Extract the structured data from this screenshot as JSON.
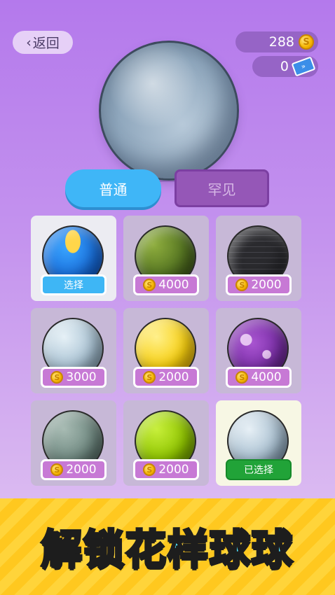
{
  "header": {
    "back_label": "返回",
    "coins": "288",
    "tickets": "0"
  },
  "tabs": [
    {
      "label": "普通",
      "active": true
    },
    {
      "label": "罕见",
      "active": false
    }
  ],
  "balls": [
    {
      "skin": "blue-flame",
      "action": "选择",
      "state": "owned"
    },
    {
      "skin": "green-camo",
      "price": "4000",
      "state": "locked"
    },
    {
      "skin": "dark-brick",
      "price": "2000",
      "state": "locked"
    },
    {
      "skin": "icy-blue",
      "price": "3000",
      "state": "locked"
    },
    {
      "skin": "yellow",
      "price": "2000",
      "state": "locked"
    },
    {
      "skin": "purple-marble",
      "price": "4000",
      "state": "locked"
    },
    {
      "skin": "gray-green-stone",
      "price": "2000",
      "state": "locked"
    },
    {
      "skin": "lime-green",
      "price": "2000",
      "state": "locked"
    },
    {
      "skin": "ice-stone",
      "action": "已选择",
      "state": "selected"
    }
  ],
  "banner": {
    "text": "解锁花样球球"
  },
  "colors": {
    "tab_active": "#3fb6f7",
    "tab_inactive": "#9557b7",
    "price_tag": "#c779d5",
    "selected_button": "#21a338",
    "banner_text": "#4fe3ff"
  }
}
